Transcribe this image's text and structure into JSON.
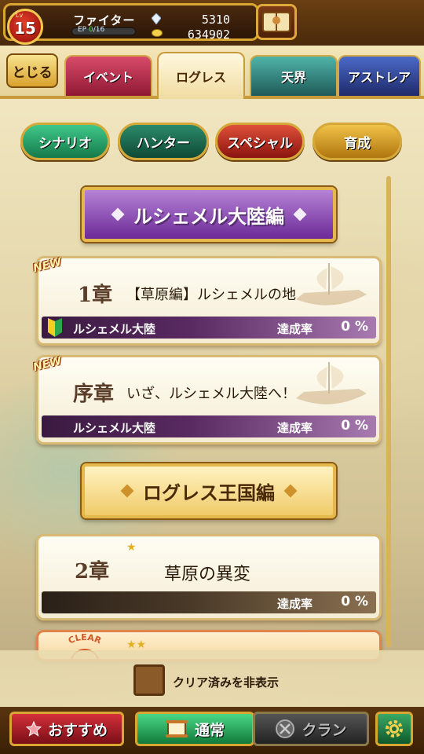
{
  "player": {
    "level_label": "Lv",
    "level": "15",
    "job": "ファイター",
    "ep_label": "EP",
    "ep_current": "0",
    "ep_max": "/16",
    "gems": "5310",
    "coins": "634902"
  },
  "nav": {
    "close_label": "とじる",
    "tabs": [
      "イベント",
      "ログレス",
      "天界",
      "アストレア"
    ],
    "active_tab": "ログレス"
  },
  "filters": [
    "シナリオ",
    "ハンター",
    "スペシャル",
    "育成"
  ],
  "sections": [
    {
      "title": "ルシェメル大陸編",
      "chapters": [
        {
          "badge": "NEW",
          "number": "1章",
          "title": "【草原編】ルシェメルの地",
          "region": "ルシェメル大陸",
          "rate_label": "達成率",
          "rate": "0 %"
        },
        {
          "badge": "NEW",
          "number": "序章",
          "title": "いざ、ルシェメル大陸へ！",
          "region": "ルシェメル大陸",
          "rate_label": "達成率",
          "rate": "0 %"
        }
      ]
    },
    {
      "title": "ログレス王国編",
      "chapters": [
        {
          "badge": "★",
          "number": "2章",
          "title": "草原の異変",
          "region": "",
          "rate_label": "達成率",
          "rate": "0 %"
        },
        {
          "badge": "★★",
          "number": "",
          "title": "",
          "region": "",
          "rate_label": "",
          "rate": ""
        }
      ]
    }
  ],
  "clear_stamp": "CLEAR",
  "hide_cleared_label": "クリア済みを非表示",
  "bottom_nav": {
    "recommend_label": "おすすめ",
    "normal_label": "通常",
    "clan_label": "クラン"
  },
  "icons": [
    "gem-icon",
    "coin-icon",
    "book-icon",
    "beginner-mark-icon",
    "ship-icon",
    "star-icon",
    "scroll-icon",
    "clan-emblem-icon",
    "gear-icon"
  ],
  "colors": {
    "gold_border": "#d9a632",
    "event_tab": "#d94b6a",
    "tenkai_tab": "#4fb4a8",
    "astrea_tab": "#4a6ac8",
    "section_purple": "#6c2a98"
  }
}
